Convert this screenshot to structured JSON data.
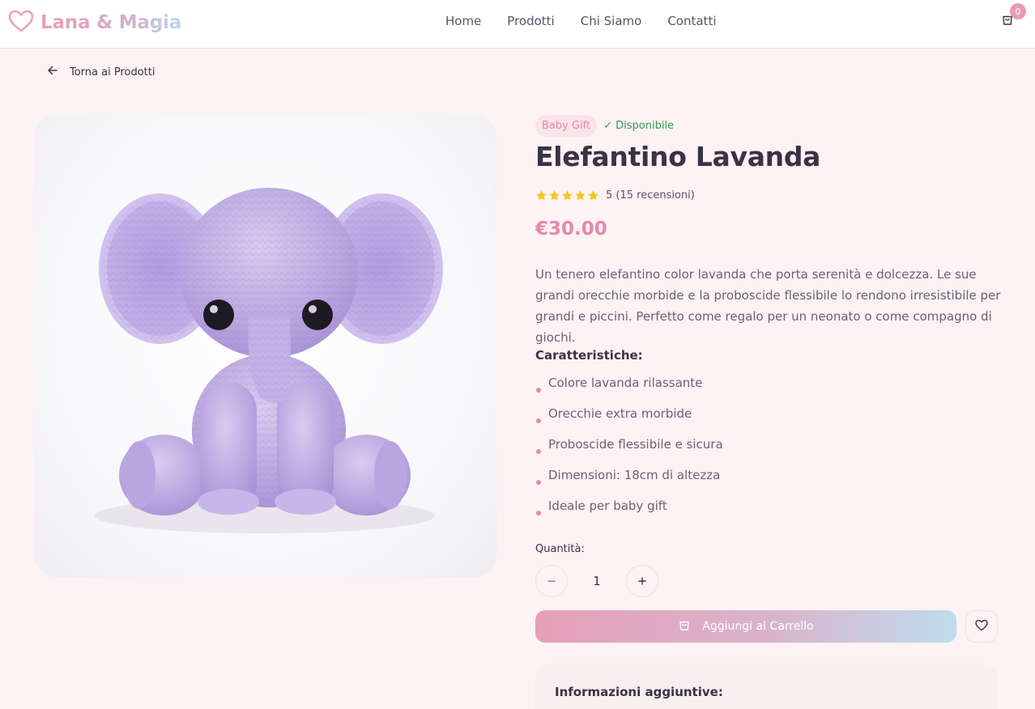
{
  "brand": {
    "name": "Lana & Magia",
    "icon": "heart-icon"
  },
  "nav": [
    {
      "label": "Home"
    },
    {
      "label": "Prodotti"
    },
    {
      "label": "Chi Siamo"
    },
    {
      "label": "Contatti"
    }
  ],
  "cart": {
    "count": "0",
    "icon": "shopping-bag-icon"
  },
  "back_link": {
    "label": "Torna ai Prodotti",
    "icon": "arrow-left-icon"
  },
  "product": {
    "category": "Baby Gift",
    "availability": "✓ Disponibile",
    "name": "Elefantino Lavanda",
    "rating_value": 5,
    "rating_text": "5 (15 recensioni)",
    "price": "€30.00",
    "description": "Un tenero elefantino color lavanda che porta serenità e dolcezza. Le sue grandi orecchie morbide e la proboscide flessibile lo rendono irresistibile per grandi e piccini. Perfetto come regalo per un neonato o come compagno di giochi.",
    "features_title": "Caratteristiche:",
    "features": [
      "Colore lavanda rilassante",
      "Orecchie extra morbide",
      "Proboscide flessibile e sicura",
      "Dimensioni: 18cm di altezza",
      "Ideale per baby gift"
    ],
    "quantity_label": "Quantità:",
    "quantity": "1",
    "add_to_cart_label": "Aggiungi al Carrello",
    "extra_info_title": "Informazioni aggiuntive:"
  },
  "colors": {
    "accent": "#e48aa8",
    "available": "#2f9a53",
    "star": "#f5c518",
    "lavender": "#c8b3e6"
  }
}
